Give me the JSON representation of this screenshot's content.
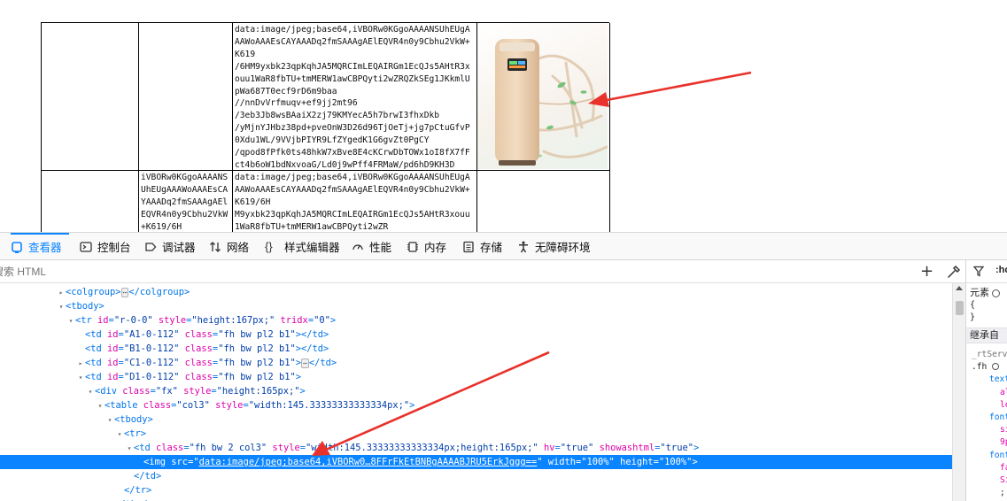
{
  "preview": {
    "cell_c1_lines": "data:image/jpeg;base64,iVBORw0KGgoAAAANSUhEUgAAAWoAAAEsCAYAAADq2fmSAAAgAElEQVR4n0y9Cbhu2VkW+K619\n/6HM9yxbk23qpKqhJA5MQRCImLEQAIRGm1EcQJs5AHtR3xouu1WaR8fbTU+tmMERW1awCBPQyti2wZRQZkSEg1JKkmlUpWa687T0ecf9rD6m9baa\n//nnDvVrfmuqv+ef9jj2mt96\n/3eb3Jb8wsBAaiX2zj79KMYecA5h7brwI3fhxDkb\n/yMjnYJHbz38pd+pveOnW3D26d96TjOeTj+jg7pCtuGfvP0Xdu1WL/9VVjbPIYR9LfZYgedK1G6gvZt0PgCY\n/qpod8fPfk0ts48hkW7xBve8E4cKCrwDbTOWx1oI8fX7fFct4b6oW1bdNxvoaG/Ld0j9wPff4FRMaW/pd6hD9KH3D",
    "cell_b2_lines": "iVBORw0KGgoAAAANSUhEUgAAAWoAAAEsCAYAAADq2fmSAAAgAElEQVR4n0y9Cbhu2VkW+K619/6H",
    "cell_c2_lines": "data:image/jpeg;base64,iVBORw0KGgoAAAANSUhEUgAAAWoAAAEsCAYAAADq2fmSAAAgAElEQVR4n0y9Cbhu2VkW+K619/6H\nM9yxbk23qpKqhJA5MQRCImLEQAIRGm1EcQJs5AHtR3xouu1WaR8fbTU+tmMERW1awCBPQyti2wZR"
  },
  "toolbar": {
    "tabs": [
      {
        "label": "查看器",
        "icon": "inspector-icon",
        "active": true
      },
      {
        "label": "控制台",
        "icon": "console-icon"
      },
      {
        "label": "调试器",
        "icon": "debugger-icon"
      },
      {
        "label": "网络",
        "icon": "network-icon"
      },
      {
        "label": "样式编辑器",
        "icon": "style-editor-icon"
      },
      {
        "label": "性能",
        "icon": "performance-icon"
      },
      {
        "label": "内存",
        "icon": "memory-icon"
      },
      {
        "label": "存储",
        "icon": "storage-icon"
      },
      {
        "label": "无障碍环境",
        "icon": "accessibility-icon"
      }
    ]
  },
  "search": {
    "placeholder": "搜索 HTML",
    "add_icon": "plus-icon",
    "picker_icon": "eyedropper-icon"
  },
  "markup": {
    "rows": [
      {
        "indent": 0,
        "tw": "▸",
        "parts": [
          [
            "tg",
            "<colgroup>"
          ],
          [
            "ell",
            "⋯"
          ],
          [
            "tg",
            "</colgroup>"
          ]
        ]
      },
      {
        "indent": 0,
        "tw": "▾",
        "parts": [
          [
            "tg",
            "<tbody>"
          ]
        ]
      },
      {
        "indent": 1,
        "tw": "▾",
        "parts": [
          [
            "tg",
            "<tr "
          ],
          [
            "an",
            "id"
          ],
          [
            "tg",
            "="
          ],
          [
            "av",
            "\"r-0-0\""
          ],
          [
            "tg",
            " "
          ],
          [
            "an",
            "style"
          ],
          [
            "tg",
            "="
          ],
          [
            "av",
            "\"height:167px;\""
          ],
          [
            "tg",
            " "
          ],
          [
            "an",
            "tridx"
          ],
          [
            "tg",
            "="
          ],
          [
            "av",
            "\"0\""
          ],
          [
            "tg",
            ">"
          ]
        ]
      },
      {
        "indent": 2,
        "tw": "",
        "parts": [
          [
            "tg",
            "<td "
          ],
          [
            "an",
            "id"
          ],
          [
            "tg",
            "="
          ],
          [
            "av",
            "\"A1-0-112\""
          ],
          [
            "tg",
            " "
          ],
          [
            "an",
            "class"
          ],
          [
            "tg",
            "="
          ],
          [
            "av",
            "\"fh bw pl2 b1\""
          ],
          [
            "tg",
            "></td>"
          ]
        ]
      },
      {
        "indent": 2,
        "tw": "",
        "parts": [
          [
            "tg",
            "<td "
          ],
          [
            "an",
            "id"
          ],
          [
            "tg",
            "="
          ],
          [
            "av",
            "\"B1-0-112\""
          ],
          [
            "tg",
            " "
          ],
          [
            "an",
            "class"
          ],
          [
            "tg",
            "="
          ],
          [
            "av",
            "\"fh bw pl2 b1\""
          ],
          [
            "tg",
            "></td>"
          ]
        ]
      },
      {
        "indent": 2,
        "tw": "▸",
        "parts": [
          [
            "tg",
            "<td "
          ],
          [
            "an",
            "id"
          ],
          [
            "tg",
            "="
          ],
          [
            "av",
            "\"C1-0-112\""
          ],
          [
            "tg",
            " "
          ],
          [
            "an",
            "class"
          ],
          [
            "tg",
            "="
          ],
          [
            "av",
            "\"fh bw pl2 b1\""
          ],
          [
            "tg",
            ">"
          ],
          [
            "ell",
            "⋯"
          ],
          [
            "tg",
            "</td>"
          ]
        ]
      },
      {
        "indent": 2,
        "tw": "▾",
        "parts": [
          [
            "tg",
            "<td "
          ],
          [
            "an",
            "id"
          ],
          [
            "tg",
            "="
          ],
          [
            "av",
            "\"D1-0-112\""
          ],
          [
            "tg",
            " "
          ],
          [
            "an",
            "class"
          ],
          [
            "tg",
            "="
          ],
          [
            "av",
            "\"fh bw pl2 b1\""
          ],
          [
            "tg",
            ">"
          ]
        ]
      },
      {
        "indent": 3,
        "tw": "▾",
        "parts": [
          [
            "tg",
            "<div "
          ],
          [
            "an",
            "class"
          ],
          [
            "tg",
            "="
          ],
          [
            "av",
            "\"fx\""
          ],
          [
            "tg",
            " "
          ],
          [
            "an",
            "style"
          ],
          [
            "tg",
            "="
          ],
          [
            "av",
            "\"height:165px;\""
          ],
          [
            "tg",
            ">"
          ]
        ]
      },
      {
        "indent": 4,
        "tw": "▾",
        "parts": [
          [
            "tg",
            "<table "
          ],
          [
            "an",
            "class"
          ],
          [
            "tg",
            "="
          ],
          [
            "av",
            "\"col3\""
          ],
          [
            "tg",
            " "
          ],
          [
            "an",
            "style"
          ],
          [
            "tg",
            "="
          ],
          [
            "av",
            "\"width:145.33333333333334px;\""
          ],
          [
            "tg",
            ">"
          ]
        ]
      },
      {
        "indent": 5,
        "tw": "▾",
        "parts": [
          [
            "tg",
            "<tbody>"
          ]
        ]
      },
      {
        "indent": 6,
        "tw": "▾",
        "parts": [
          [
            "tg",
            "<tr>"
          ]
        ]
      },
      {
        "indent": 7,
        "tw": "▾",
        "parts": [
          [
            "tg",
            "<td "
          ],
          [
            "an",
            "class"
          ],
          [
            "tg",
            "="
          ],
          [
            "av",
            "\"fh bw 2 col3\""
          ],
          [
            "tg",
            " "
          ],
          [
            "an",
            "style"
          ],
          [
            "tg",
            "="
          ],
          [
            "av",
            "\"width:145.33333333333334px;height:165px;\""
          ],
          [
            "tg",
            " "
          ],
          [
            "an",
            "hv"
          ],
          [
            "tg",
            "="
          ],
          [
            "av",
            "\"true\""
          ],
          [
            "tg",
            " "
          ],
          [
            "an",
            "showashtml"
          ],
          [
            "tg",
            "="
          ],
          [
            "av",
            "\"true\""
          ],
          [
            "tg",
            ">"
          ]
        ]
      },
      {
        "indent": 8,
        "tw": "",
        "selected": true,
        "parts": [
          [
            "tg",
            "<img "
          ],
          [
            "an",
            "src"
          ],
          [
            "tg",
            "="
          ],
          [
            "tg",
            "\""
          ],
          [
            "avl",
            "data:image/jpeg;base64,iVBORw0…8FFrFkEtBNBgAAAABJRU5ErkJggg=="
          ],
          [
            "tg",
            "\""
          ],
          [
            "tg",
            " "
          ],
          [
            "an",
            "width"
          ],
          [
            "tg",
            "="
          ],
          [
            "av",
            "\"100%\""
          ],
          [
            "tg",
            " "
          ],
          [
            "an",
            "height"
          ],
          [
            "tg",
            "="
          ],
          [
            "av",
            "\"100%\""
          ],
          [
            "tg",
            ">"
          ]
        ]
      },
      {
        "indent": 7,
        "tw": "",
        "parts": [
          [
            "tg",
            "</td>"
          ]
        ]
      },
      {
        "indent": 6,
        "tw": "",
        "parts": [
          [
            "tg",
            "</tr>"
          ]
        ]
      },
      {
        "indent": 5,
        "tw": "",
        "parts": [
          [
            "tg",
            "</tbody>"
          ]
        ]
      }
    ]
  },
  "sidepanel": {
    "filter_icon": "filter-icon",
    "hov": ":ho",
    "element_label": "元素",
    "brace_open": "{",
    "brace_close": "}",
    "inherited": "继承自",
    "rt": "_rtServ",
    "fh": ".fh",
    "p1": "text",
    "p1a": "al",
    "p1b": "le",
    "p2": "font",
    "p2a": "si",
    "p2b": "9p",
    "p3": "font",
    "p3a": "fa",
    "p3b": "Si",
    "semi": ";"
  },
  "colors": {
    "accent": "#0a84ff",
    "selected_row": "#0a84ff",
    "arrow": "#e8322b"
  }
}
